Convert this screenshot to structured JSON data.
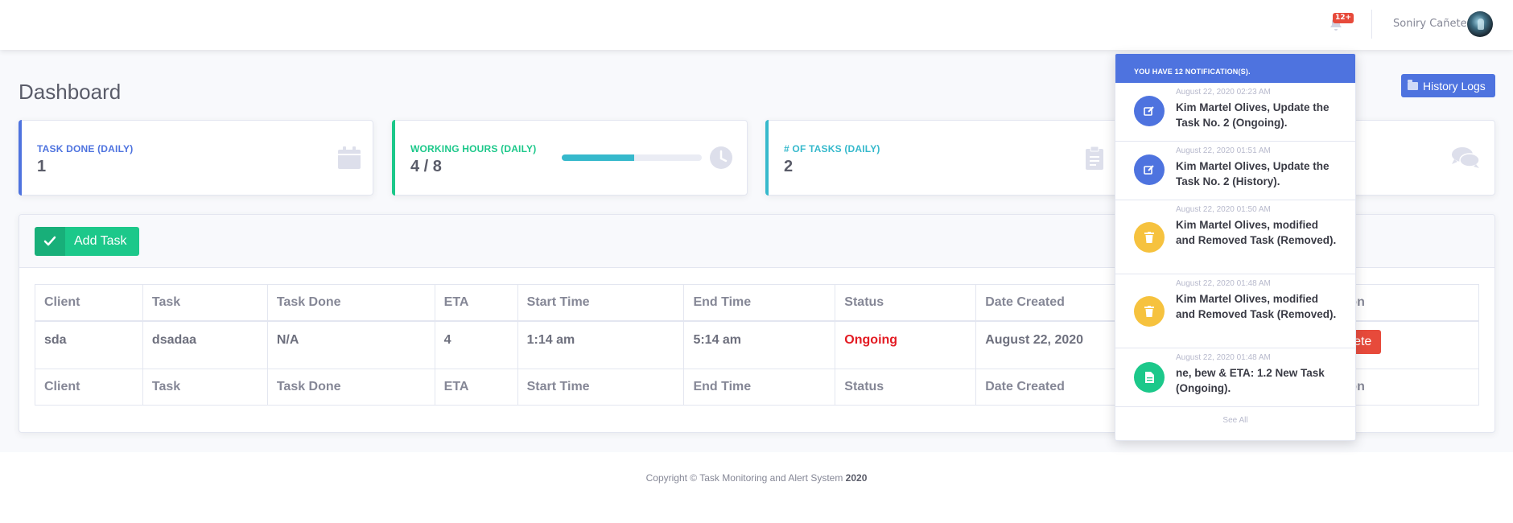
{
  "topbar": {
    "notification_badge": "12+",
    "username": "Soniry Cañete"
  },
  "page": {
    "title": "Dashboard",
    "history_button": "History Logs"
  },
  "cards": [
    {
      "label": "Task Done (Daily)",
      "value": "1",
      "color": "#4e73df",
      "icon": "calendar-icon"
    },
    {
      "label": "Working Hours (Daily)",
      "value": "4 / 8",
      "color": "#1cc88a",
      "icon": "clock-icon",
      "progress": 0.52
    },
    {
      "label": "# of Tasks (Daily)",
      "value": "2",
      "color": "#36b9cc",
      "icon": "clipboard-icon"
    },
    {
      "label": "",
      "value": "",
      "color": "#f6c23e",
      "icon": "comments-icon"
    }
  ],
  "panel": {
    "add_button": "Add Task",
    "columns": [
      "Client",
      "Task",
      "Task Done",
      "ETA",
      "Start Time",
      "End Time",
      "Status",
      "Date Created",
      "Action"
    ],
    "rows": [
      {
        "client": "sda",
        "task": "dsadaa",
        "task_done": "N/A",
        "eta": "4",
        "start": "1:14 am",
        "end": "5:14 am",
        "status": "Ongoing",
        "date": "August 22, 2020",
        "delete_label": "Delete"
      }
    ]
  },
  "notifications": {
    "header": "You have 12 notification(s).",
    "items": [
      {
        "date": "August 22, 2020 02:23 AM",
        "text": "Kim Martel Olives, Update the Task No. 2 (Ongoing).",
        "icon": "edit-icon",
        "color": "#4e73df"
      },
      {
        "date": "August 22, 2020 01:51 AM",
        "text": "Kim Martel Olives, Update the Task No. 2 (History).",
        "icon": "edit-icon",
        "color": "#4e73df"
      },
      {
        "date": "August 22, 2020 01:50 AM",
        "text": "Kim Martel Olives, modified and Removed Task (Removed).",
        "icon": "trash-icon",
        "color": "#f6c23e"
      },
      {
        "date": "August 22, 2020 01:48 AM",
        "text": "Kim Martel Olives, modified and Removed Task (Removed).",
        "icon": "trash-icon",
        "color": "#f6c23e"
      },
      {
        "date": "August 22, 2020 01:48 AM",
        "text": "ne, bew & ETA: 1.2 New Task (Ongoing).",
        "icon": "file-icon",
        "color": "#1cc88a"
      }
    ],
    "see_all": "See All"
  },
  "footer": {
    "text": "Copyright © Task Monitoring and Alert System ",
    "year": "2020"
  }
}
